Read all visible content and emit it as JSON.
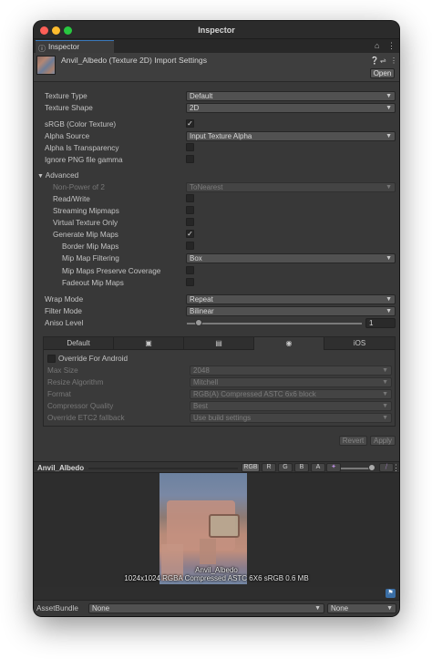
{
  "window": {
    "title": "Inspector",
    "close_color": "#fe5f57",
    "min_color": "#febc2e",
    "max_color": "#28c840"
  },
  "tab": {
    "label": "Inspector",
    "icon": "info-icon",
    "lock_icon": "lock-icon",
    "menu_icon": "kebab-menu-icon"
  },
  "header": {
    "title": "Anvil_Albedo (Texture 2D) Import Settings",
    "help_icon": "help-icon",
    "presets_icon": "presets-icon",
    "menu_icon": "kebab-menu-icon",
    "open_label": "Open"
  },
  "settings": {
    "texture_type": {
      "label": "Texture Type",
      "value": "Default"
    },
    "texture_shape": {
      "label": "Texture Shape",
      "value": "2D"
    },
    "srgb": {
      "label": "sRGB (Color Texture)",
      "checked": true
    },
    "alpha_source": {
      "label": "Alpha Source",
      "value": "Input Texture Alpha"
    },
    "alpha_is_transparency": {
      "label": "Alpha Is Transparency",
      "checked": false
    },
    "ignore_png_gamma": {
      "label": "Ignore PNG file gamma",
      "checked": false
    }
  },
  "advanced": {
    "label": "Advanced",
    "non_power_of_2": {
      "label": "Non-Power of 2",
      "value": "ToNearest"
    },
    "read_write": {
      "label": "Read/Write",
      "checked": false
    },
    "streaming_mipmaps": {
      "label": "Streaming Mipmaps",
      "checked": false
    },
    "virtual_texture_only": {
      "label": "Virtual Texture Only",
      "checked": false
    },
    "generate_mip_maps": {
      "label": "Generate Mip Maps",
      "checked": true
    },
    "border_mip_maps": {
      "label": "Border Mip Maps",
      "checked": false
    },
    "mip_map_filtering": {
      "label": "Mip Map Filtering",
      "value": "Box"
    },
    "mip_maps_preserve_coverage": {
      "label": "Mip Maps Preserve Coverage",
      "checked": false
    },
    "fadeout_mip_maps": {
      "label": "Fadeout Mip Maps",
      "checked": false
    }
  },
  "wrap": {
    "wrap_mode": {
      "label": "Wrap Mode",
      "value": "Repeat"
    },
    "filter_mode": {
      "label": "Filter Mode",
      "value": "Bilinear"
    },
    "aniso_level": {
      "label": "Aniso Level",
      "value": "1",
      "level": 1
    }
  },
  "platform_tabs": [
    {
      "label": "Default",
      "icon": ""
    },
    {
      "label": "",
      "icon": "monitor-icon"
    },
    {
      "label": "",
      "icon": "server-icon"
    },
    {
      "label": "",
      "icon": "android-icon"
    },
    {
      "label": "iOS",
      "icon": ""
    }
  ],
  "platform": {
    "override_label": "Override For Android",
    "override_checked": false,
    "max_size": {
      "label": "Max Size",
      "value": "2048"
    },
    "resize_algorithm": {
      "label": "Resize Algorithm",
      "value": "Mitchell"
    },
    "format": {
      "label": "Format",
      "value": "RGB(A) Compressed ASTC 6x6 block"
    },
    "compressor_quality": {
      "label": "Compressor Quality",
      "value": "Best"
    },
    "override_etc2": {
      "label": "Override ETC2 fallback",
      "value": "Use build settings"
    }
  },
  "actions": {
    "revert": "Revert",
    "apply": "Apply"
  },
  "preview": {
    "name": "Anvil_Albedo",
    "channels": [
      "RGB",
      "R",
      "G",
      "B",
      "A"
    ],
    "caption_name": "Anvil_Albedo",
    "caption_info": "1024x1024  RGBA Compressed ASTC 6X6 sRGB   0.6 MB"
  },
  "assetbundle": {
    "label": "AssetBundle",
    "name_value": "None",
    "variant_value": "None"
  }
}
